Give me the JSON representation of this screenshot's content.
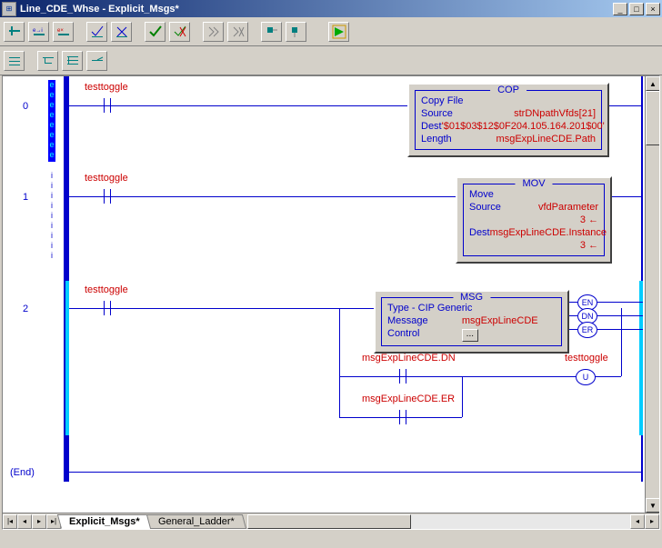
{
  "window": {
    "title": "Line_CDE_Whse - Explicit_Msgs*"
  },
  "tabs": {
    "active": "Explicit_Msgs*",
    "inactive": "General_Ladder*"
  },
  "rungs": [
    {
      "num": "0",
      "edit_flag": "e",
      "contact_label": "testtoggle",
      "instr": {
        "mnemonic": "COP",
        "rows": [
          {
            "lab": "Copy File",
            "val": ""
          },
          {
            "lab": "Source",
            "val": "strDNpathVfds[21]"
          },
          {
            "lab": "Dest",
            "val": "'$01$03$12$0F204.105.164.201$00'"
          },
          {
            "lab": "Length",
            "val": "msgExpLineCDE.Path"
          }
        ]
      }
    },
    {
      "num": "1",
      "edit_flag": "i",
      "contact_label": "testtoggle",
      "instr": {
        "mnemonic": "MOV",
        "rows": [
          {
            "lab": "Move",
            "val": ""
          },
          {
            "lab": "Source",
            "val": "vfdParameter"
          },
          {
            "lab": "",
            "val": "3 ←"
          },
          {
            "lab": "Dest",
            "val": "msgExpLineCDE.Instance"
          },
          {
            "lab": "",
            "val": "3 ←"
          }
        ]
      }
    },
    {
      "num": "2",
      "edit_flag": "",
      "contact_label": "testtoggle",
      "instr": {
        "mnemonic": "MSG",
        "rows": [
          {
            "lab": "Type - CIP Generic",
            "val": ""
          },
          {
            "lab": "Message Control",
            "val": "msgExpLineCDE"
          }
        ],
        "outputs": [
          "EN",
          "DN",
          "ER"
        ]
      },
      "branch": {
        "contact1": "msgExpLineCDE.DN",
        "contact2": "msgExpLineCDE.ER",
        "coil_label": "testtoggle",
        "coil_type": "U"
      }
    }
  ],
  "end_label": "(End)"
}
